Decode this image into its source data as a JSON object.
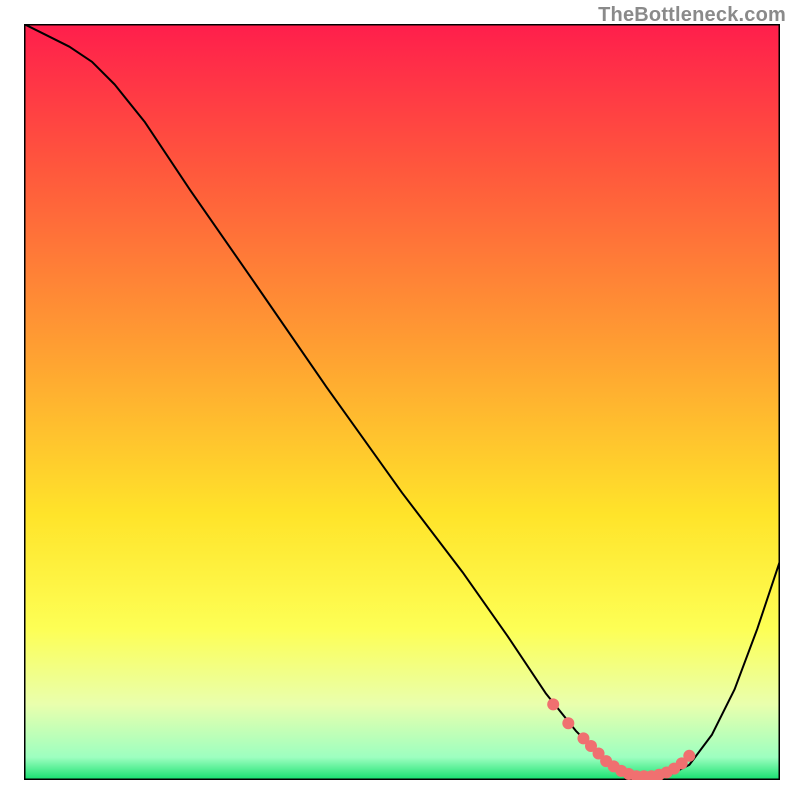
{
  "watermark": "TheBottleneck.com",
  "chart_data": {
    "type": "line",
    "title": "",
    "xlabel": "",
    "ylabel": "",
    "xlim": [
      0,
      100
    ],
    "ylim": [
      0,
      100
    ],
    "background_gradient": {
      "stops": [
        {
          "offset": 0.0,
          "color": "#ff1e4c"
        },
        {
          "offset": 0.2,
          "color": "#ff5a3c"
        },
        {
          "offset": 0.45,
          "color": "#ffa531"
        },
        {
          "offset": 0.65,
          "color": "#ffe42a"
        },
        {
          "offset": 0.8,
          "color": "#fdff55"
        },
        {
          "offset": 0.9,
          "color": "#e9ffad"
        },
        {
          "offset": 0.97,
          "color": "#9dffc0"
        },
        {
          "offset": 1.0,
          "color": "#14e06e"
        }
      ]
    },
    "series": [
      {
        "name": "bottleneck-curve",
        "color": "#000000",
        "stroke_width": 2,
        "x": [
          0,
          3,
          6,
          9,
          12,
          16,
          22,
          30,
          40,
          50,
          58,
          64,
          69,
          73,
          76,
          79,
          82,
          85,
          88,
          91,
          94,
          97,
          100
        ],
        "y": [
          100,
          98.5,
          97,
          95,
          92,
          87,
          78,
          66.5,
          52,
          38,
          27.5,
          19,
          11.5,
          6.5,
          3.5,
          1.5,
          0.5,
          0.5,
          2,
          6,
          12,
          20,
          29
        ]
      },
      {
        "name": "optimal-dots",
        "color": "#f07070",
        "marker": "circle",
        "marker_size": 6,
        "draw_line": false,
        "x": [
          70,
          72,
          74,
          75,
          76,
          77,
          78,
          79,
          80,
          81,
          82,
          83,
          84,
          85,
          86,
          87,
          88
        ],
        "y": [
          10,
          7.5,
          5.5,
          4.5,
          3.5,
          2.5,
          1.8,
          1.2,
          0.8,
          0.5,
          0.5,
          0.5,
          0.7,
          1,
          1.5,
          2.2,
          3.2
        ]
      }
    ]
  }
}
